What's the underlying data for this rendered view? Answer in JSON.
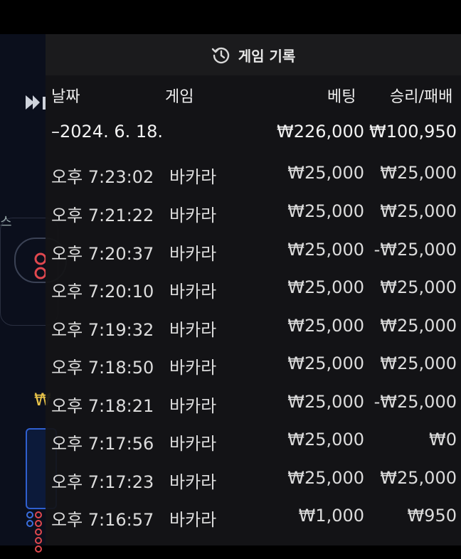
{
  "header": {
    "title": "게임 기록",
    "icon": "history-icon"
  },
  "columns": {
    "date": "날짜",
    "game": "게임",
    "bet": "베팅",
    "result": "승리/패배"
  },
  "group": {
    "date": "–2024. 6. 18.",
    "bet": "₩226,000",
    "result": "₩100,950"
  },
  "rows": [
    {
      "time": "오후 7:23:02",
      "game": "바카라",
      "bet": "₩25,000",
      "result": "₩25,000"
    },
    {
      "time": "오후 7:21:22",
      "game": "바카라",
      "bet": "₩25,000",
      "result": "₩25,000"
    },
    {
      "time": "오후 7:20:37",
      "game": "바카라",
      "bet": "₩25,000",
      "result": "-₩25,000"
    },
    {
      "time": "오후 7:20:10",
      "game": "바카라",
      "bet": "₩25,000",
      "result": "₩25,000"
    },
    {
      "time": "오후 7:19:32",
      "game": "바카라",
      "bet": "₩25,000",
      "result": "₩25,000"
    },
    {
      "time": "오후 7:18:50",
      "game": "바카라",
      "bet": "₩25,000",
      "result": "₩25,000"
    },
    {
      "time": "오후 7:18:21",
      "game": "바카라",
      "bet": "₩25,000",
      "result": "-₩25,000"
    },
    {
      "time": "오후 7:17:56",
      "game": "바카라",
      "bet": "₩25,000",
      "result": "₩0"
    },
    {
      "time": "오후 7:17:23",
      "game": "바카라",
      "bet": "₩25,000",
      "result": "₩25,000"
    },
    {
      "time": "오후 7:16:57",
      "game": "바카라",
      "bet": "₩1,000",
      "result": "₩950"
    }
  ],
  "background": {
    "currency_glyph": "₩",
    "side_char": "스"
  },
  "colors": {
    "panel_bg": "#141416",
    "header_bg": "#1b1b1d",
    "bg_app": "#0b0f1c",
    "accent_blue": "#2f5fd0",
    "accent_red": "#e0484f",
    "accent_yellow": "#e9c449"
  }
}
